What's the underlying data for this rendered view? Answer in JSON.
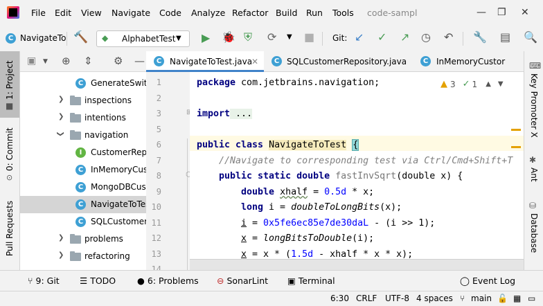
{
  "menubar": {
    "items": [
      "File",
      "Edit",
      "View",
      "Navigate",
      "Code",
      "Analyze",
      "Refactor",
      "Build",
      "Run",
      "Tools"
    ],
    "project_name": "code-sampl"
  },
  "toolbar": {
    "breadcrumb": "NavigateTo",
    "run_config": "AlphabetTest",
    "git_label": "Git:"
  },
  "left_stripe": {
    "project": "1: Project",
    "commit": "0: Commit",
    "pull_requests": "Pull Requests"
  },
  "right_stripe": {
    "key_promoter": "Key Promoter X",
    "ant": "Ant",
    "database": "Database"
  },
  "tree": {
    "rows": [
      {
        "label": "GenerateSwitch",
        "type": "class"
      },
      {
        "label": "inspections",
        "type": "folder"
      },
      {
        "label": "intentions",
        "type": "folder"
      },
      {
        "label": "navigation",
        "type": "folder-open"
      },
      {
        "label": "CustomerRepo",
        "type": "interface"
      },
      {
        "label": "InMemoryCust",
        "type": "class"
      },
      {
        "label": "MongoDBCust",
        "type": "class"
      },
      {
        "label": "NavigateToTest",
        "type": "class",
        "selected": true
      },
      {
        "label": "SQLCustomerR",
        "type": "class"
      },
      {
        "label": "problems",
        "type": "folder"
      },
      {
        "label": "refactoring",
        "type": "folder"
      }
    ]
  },
  "tabs": [
    {
      "label": "NavigateToTest.java",
      "active": true
    },
    {
      "label": "SQLCustomerRepository.java"
    },
    {
      "label": "InMemoryCustor"
    }
  ],
  "inspections": {
    "warnings": "3",
    "weak": "1"
  },
  "editor": {
    "line_numbers": [
      "1",
      "2",
      "3",
      "5",
      "6",
      "7",
      "8",
      "9",
      "10",
      "11",
      "12",
      "13",
      "14"
    ],
    "l1_kw": "package",
    "l1_rest": " com.jetbrains.navigation;",
    "l3_kw": "import",
    "l3_rest": " ...",
    "l6_kw": "public class",
    "l6_name": "NavigateToTest",
    "l6_brace": "{",
    "l7_comment": "//Navigate to corresponding test via Ctrl/Cmd+Shift+T",
    "l8_kw": "public static double",
    "l8_name": "fastInvSqrt",
    "l8_rest": "(double x) {",
    "l9_kw": "double",
    "l9_var": "xhalf",
    "l9_eq": " = ",
    "l9_num": "0.5d",
    "l9_rest": " * x;",
    "l10_kw": "long",
    "l10_rest1": " i = ",
    "l10_call": "doubleToLongBits",
    "l10_rest2": "(x);",
    "l11_var": "i",
    "l11_eq": " = ",
    "l11_num": "0x5fe6ec85e7de30daL",
    "l11_rest": " - (i >> 1);",
    "l12_var": "x",
    "l12_eq": " = ",
    "l12_call": "longBitsToDouble",
    "l12_rest": "(i);",
    "l13_var": "x",
    "l13_rest1": " = x * (",
    "l13_num": "1.5d",
    "l13_rest2": " - xhalf * x * x);"
  },
  "bottom_bar": {
    "git": "9: Git",
    "todo": "TODO",
    "problems": "6: Problems",
    "sonarlint": "SonarLint",
    "terminal": "Terminal",
    "event_log": "Event Log"
  },
  "status_bar": {
    "position": "6:30",
    "line_sep": "CRLF",
    "encoding": "UTF-8",
    "indent": "4 spaces",
    "branch": "main"
  },
  "colors": {
    "accent": "#4083c9",
    "run_green": "#499c54",
    "class_icon": "#3ea0d4",
    "interface_icon": "#62b543"
  }
}
